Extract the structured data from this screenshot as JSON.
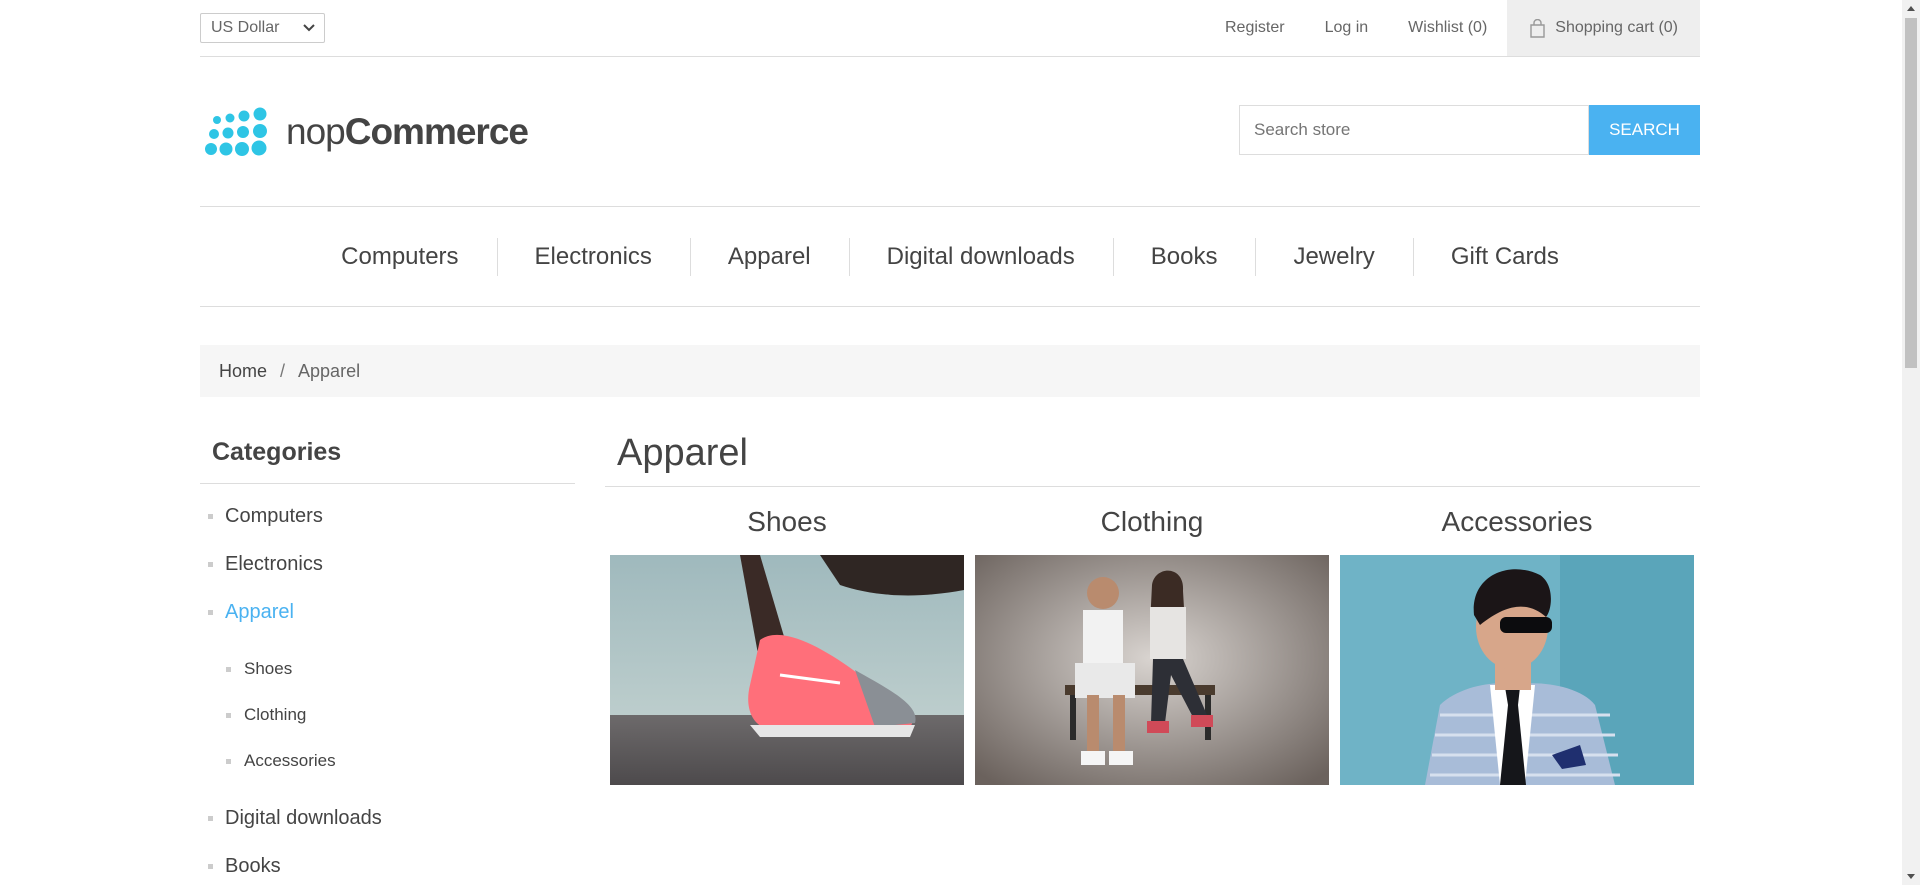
{
  "header": {
    "currency": "US Dollar",
    "links": {
      "register": "Register",
      "login": "Log in",
      "wishlist": "Wishlist (0)",
      "cart": "Shopping cart (0)"
    }
  },
  "logo": {
    "text_light": "nop",
    "text_bold": "Commerce",
    "brand_color": "#2ec5e5"
  },
  "search": {
    "placeholder": "Search store",
    "button": "SEARCH",
    "accent": "#4ab2f1"
  },
  "menu": [
    "Computers",
    "Electronics",
    "Apparel",
    "Digital downloads",
    "Books",
    "Jewelry",
    "Gift Cards"
  ],
  "breadcrumb": {
    "home": "Home",
    "separator": "/",
    "current": "Apparel"
  },
  "sidebar": {
    "title": "Categories",
    "items": [
      "Computers",
      "Electronics",
      "Apparel"
    ],
    "subitems": [
      "Shoes",
      "Clothing",
      "Accessories"
    ],
    "after": [
      "Digital downloads",
      "Books"
    ]
  },
  "main": {
    "title": "Apparel",
    "categories": [
      {
        "name": "Shoes",
        "image": "sneaker-photo"
      },
      {
        "name": "Clothing",
        "image": "couple-photo"
      },
      {
        "name": "Accessories",
        "image": "man-sunglasses-photo"
      }
    ]
  }
}
